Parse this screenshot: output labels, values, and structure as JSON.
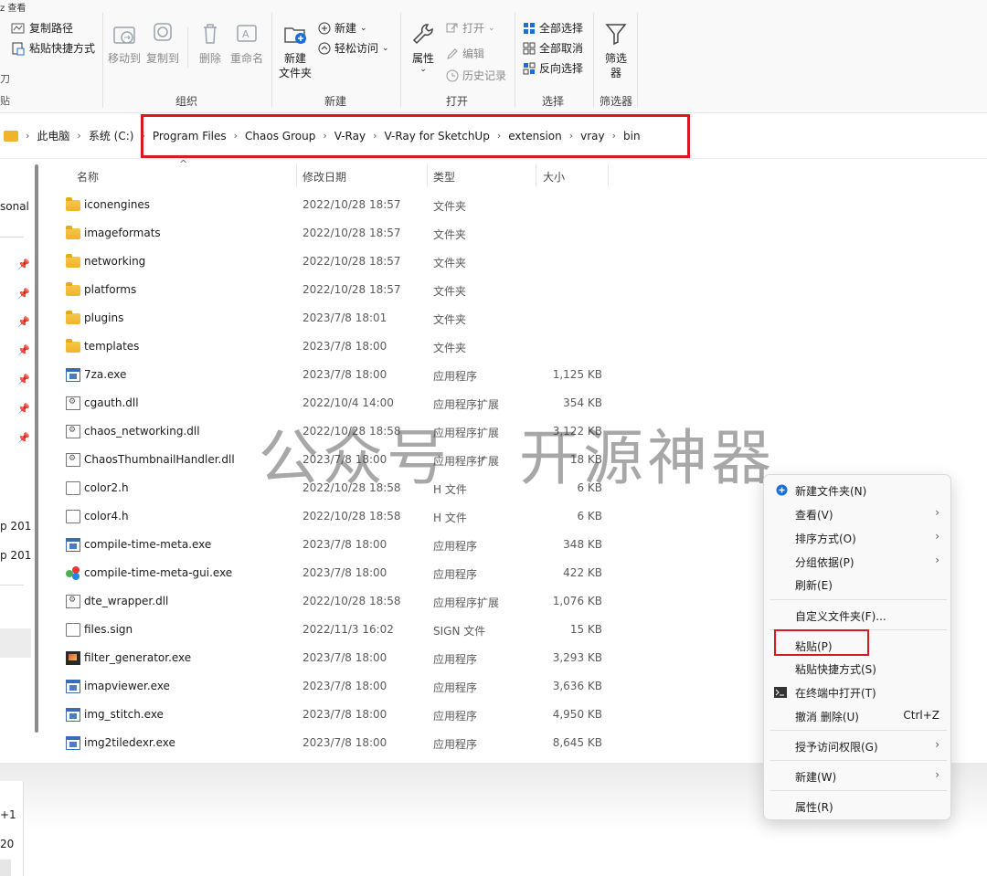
{
  "ribbon": {
    "top_strip": "z     查看",
    "clipboard": {
      "copy_path": "复制路径",
      "paste_shortcut": "粘贴快捷方式"
    },
    "organize": {
      "move_to": "移动到",
      "copy_to": "复制到",
      "delete": "删除",
      "rename": "重命名",
      "label": "组织"
    },
    "new": {
      "new_folder": "新建\n文件夹",
      "new_folder_l1": "新建",
      "new_folder_l2": "文件夹",
      "new_item": "新建",
      "easy_access": "轻松访问",
      "label": "新建"
    },
    "open": {
      "properties": "属性",
      "open": "打开",
      "edit": "编辑",
      "history": "历史记录",
      "label": "打开"
    },
    "select": {
      "select_all": "全部选择",
      "select_none": "全部取消",
      "invert": "反向选择",
      "label": "选择"
    },
    "filter": {
      "filter_l1": "筛选",
      "filter_l2": "器",
      "label": "筛选器"
    },
    "left_cut": {
      "a": "刀",
      "b": "贴"
    }
  },
  "address": {
    "crumbs": [
      "此电脑",
      "系统 (C:)",
      "Program Files",
      "Chaos Group",
      "V-Ray",
      "V-Ray for SketchUp",
      "extension",
      "vray",
      "bin"
    ]
  },
  "nav": {
    "personal": "sonal",
    "p2019a": "p 201",
    "p2019b": "p 201"
  },
  "columns": {
    "name": "名称",
    "modified": "修改日期",
    "type": "类型",
    "size": "大小"
  },
  "files": [
    {
      "name": "iconengines",
      "date": "2022/10/28 18:57",
      "type": "文件夹",
      "size": "",
      "icon": "folder"
    },
    {
      "name": "imageformats",
      "date": "2022/10/28 18:57",
      "type": "文件夹",
      "size": "",
      "icon": "folder"
    },
    {
      "name": "networking",
      "date": "2022/10/28 18:57",
      "type": "文件夹",
      "size": "",
      "icon": "folder"
    },
    {
      "name": "platforms",
      "date": "2022/10/28 18:57",
      "type": "文件夹",
      "size": "",
      "icon": "folder"
    },
    {
      "name": "plugins",
      "date": "2023/7/8 18:01",
      "type": "文件夹",
      "size": "",
      "icon": "folder"
    },
    {
      "name": "templates",
      "date": "2023/7/8 18:00",
      "type": "文件夹",
      "size": "",
      "icon": "folder"
    },
    {
      "name": "7za.exe",
      "date": "2023/7/8 18:00",
      "type": "应用程序",
      "size": "1,125 KB",
      "icon": "exe"
    },
    {
      "name": "cgauth.dll",
      "date": "2022/10/4 14:00",
      "type": "应用程序扩展",
      "size": "354 KB",
      "icon": "dll"
    },
    {
      "name": "chaos_networking.dll",
      "date": "2022/10/28 18:58",
      "type": "应用程序扩展",
      "size": "3,122 KB",
      "icon": "dll"
    },
    {
      "name": "ChaosThumbnailHandler.dll",
      "date": "2023/7/8 18:00",
      "type": "应用程序扩展",
      "size": "18 KB",
      "icon": "dll"
    },
    {
      "name": "color2.h",
      "date": "2022/10/28 18:58",
      "type": "H 文件",
      "size": "6 KB",
      "icon": "doc"
    },
    {
      "name": "color4.h",
      "date": "2022/10/28 18:58",
      "type": "H 文件",
      "size": "6 KB",
      "icon": "doc"
    },
    {
      "name": "compile-time-meta.exe",
      "date": "2023/7/8 18:00",
      "type": "应用程序",
      "size": "348 KB",
      "icon": "exe"
    },
    {
      "name": "compile-time-meta-gui.exe",
      "date": "2023/7/8 18:00",
      "type": "应用程序",
      "size": "422 KB",
      "icon": "gui"
    },
    {
      "name": "dte_wrapper.dll",
      "date": "2022/10/28 18:58",
      "type": "应用程序扩展",
      "size": "1,076 KB",
      "icon": "dll"
    },
    {
      "name": "files.sign",
      "date": "2022/11/3 16:02",
      "type": "SIGN 文件",
      "size": "15 KB",
      "icon": "doc"
    },
    {
      "name": "filter_generator.exe",
      "date": "2023/7/8 18:00",
      "type": "应用程序",
      "size": "3,293 KB",
      "icon": "img"
    },
    {
      "name": "imapviewer.exe",
      "date": "2023/7/8 18:00",
      "type": "应用程序",
      "size": "3,636 KB",
      "icon": "exe"
    },
    {
      "name": "img_stitch.exe",
      "date": "2023/7/8 18:00",
      "type": "应用程序",
      "size": "4,950 KB",
      "icon": "exe"
    },
    {
      "name": "img2tiledexr.exe",
      "date": "2023/7/8 18:00",
      "type": "应用程序",
      "size": "8,645 KB",
      "icon": "exe"
    }
  ],
  "watermark": "公众号 · 开源神器",
  "bottom": {
    "a": "+1",
    "b": "20"
  },
  "context_menu": {
    "new_folder": "新建文件夹(N)",
    "view": "查看(V)",
    "sort_by": "排序方式(O)",
    "group_by": "分组依据(P)",
    "refresh": "刷新(E)",
    "customize": "自定义文件夹(F)...",
    "paste": "粘贴(P)",
    "paste_shortcut": "粘贴快捷方式(S)",
    "open_terminal": "在终端中打开(T)",
    "undo_delete": "撤消 删除(U)",
    "undo_shortcut": "Ctrl+Z",
    "grant_access": "授予访问权限(G)",
    "new": "新建(W)",
    "properties": "属性(R)"
  },
  "colors": {
    "highlight_red": "#d8191f",
    "folder": "#f0b429",
    "accent_blue": "#1a6fd6"
  }
}
